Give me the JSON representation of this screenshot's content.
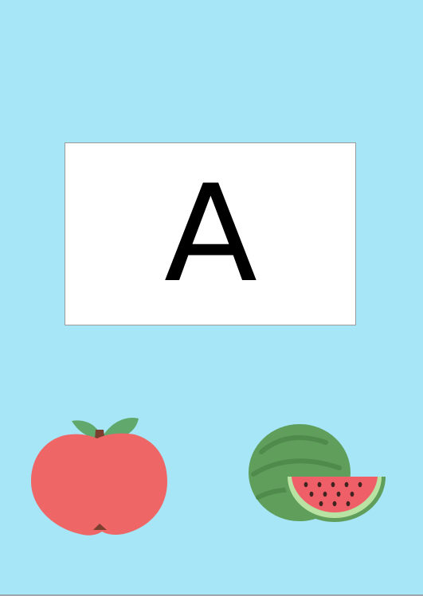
{
  "colors": {
    "background": "#a6e6f6",
    "card": "#ffffff",
    "card_border": "#9b9b9b",
    "letter": "#000000",
    "apple_body": "#ef6666",
    "apple_leaf": "#60a86c",
    "apple_stem": "#7b3f2f",
    "melon_rind": "#5f9e5b",
    "melon_stripe": "#4f8b4b",
    "melon_flesh": "#ef5f67",
    "melon_inner_rind": "#b8e3a3",
    "melon_seed": "#3f2420"
  },
  "card": {
    "letter": "A"
  },
  "fruits": [
    {
      "name": "apple",
      "icon": "apple-icon"
    },
    {
      "name": "watermelon",
      "icon": "watermelon-icon"
    }
  ]
}
